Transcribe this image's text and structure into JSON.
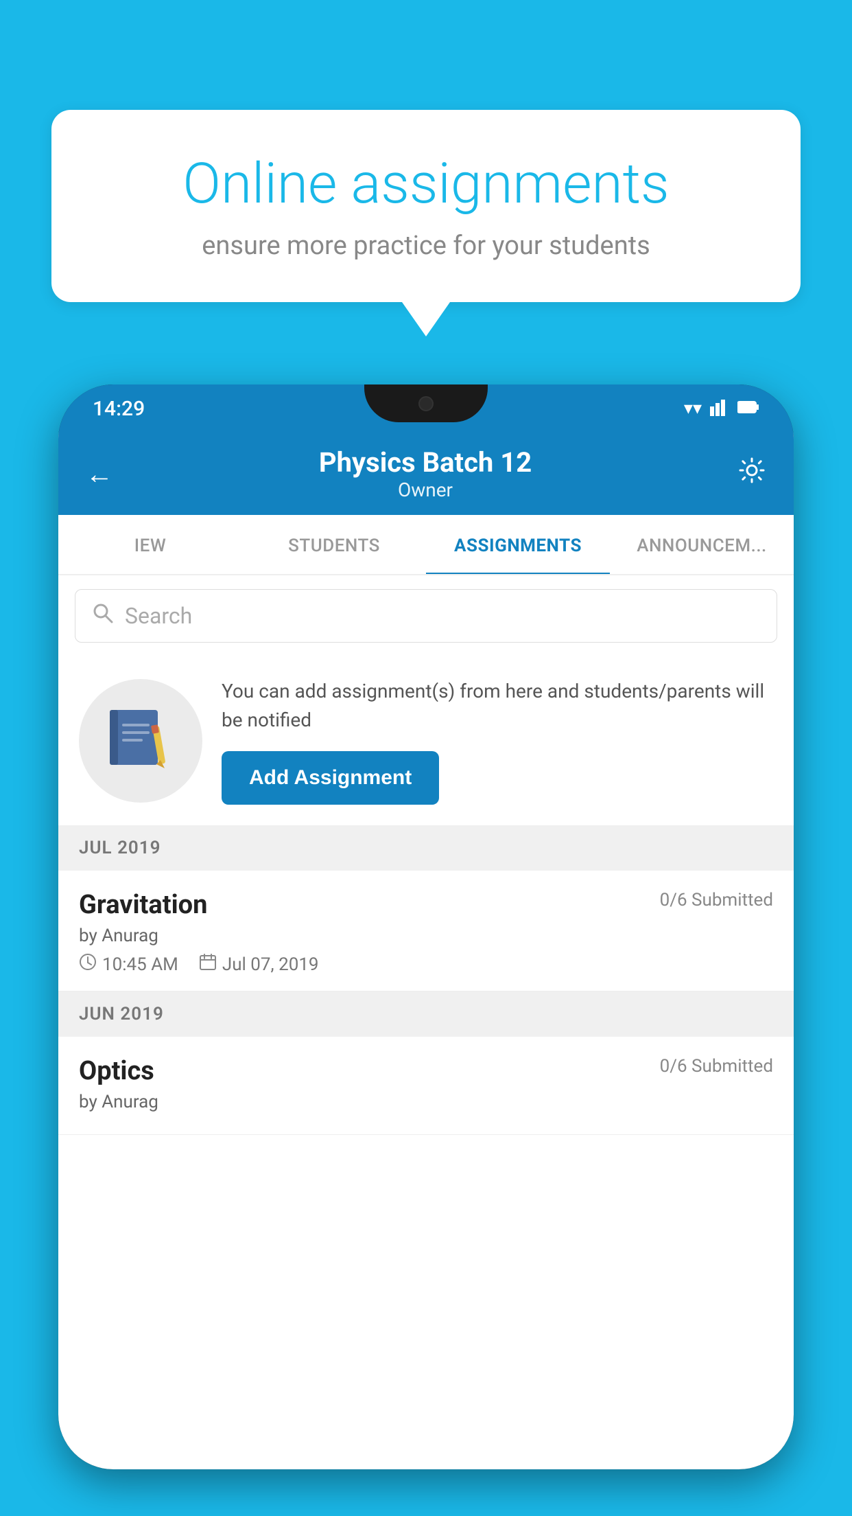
{
  "background_color": "#1ab8e8",
  "bubble": {
    "title": "Online assignments",
    "subtitle": "ensure more practice for your students"
  },
  "app": {
    "status_bar": {
      "time": "14:29",
      "icons": [
        "wifi",
        "signal",
        "battery"
      ]
    },
    "header": {
      "title": "Physics Batch 12",
      "subtitle": "Owner",
      "back_label": "←",
      "settings_label": "⚙"
    },
    "tabs": [
      {
        "label": "IEW",
        "active": false
      },
      {
        "label": "STUDENTS",
        "active": false
      },
      {
        "label": "ASSIGNMENTS",
        "active": true
      },
      {
        "label": "ANNOUNCEM...",
        "active": false
      }
    ],
    "search": {
      "placeholder": "Search"
    },
    "promo": {
      "description": "You can add assignment(s) from here and students/parents will be notified",
      "button_label": "Add Assignment"
    },
    "sections": [
      {
        "label": "JUL 2019",
        "assignments": [
          {
            "title": "Gravitation",
            "submitted": "0/6 Submitted",
            "author": "by Anurag",
            "time": "10:45 AM",
            "date": "Jul 07, 2019"
          }
        ]
      },
      {
        "label": "JUN 2019",
        "assignments": [
          {
            "title": "Optics",
            "submitted": "0/6 Submitted",
            "author": "by Anurag",
            "time": "",
            "date": ""
          }
        ]
      }
    ]
  }
}
